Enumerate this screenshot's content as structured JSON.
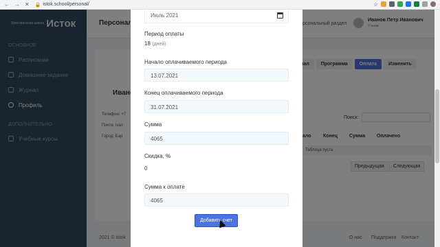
{
  "browser": {
    "url": "istok.school/personal/"
  },
  "sidebar": {
    "brand_small": "Христианская школа",
    "brand_name": "Исток",
    "section_main": "ОСНОВНОЕ",
    "items": [
      {
        "label": "Расписание"
      },
      {
        "label": "Домашнее задание"
      },
      {
        "label": "Журнал"
      },
      {
        "label": "Профиль"
      }
    ],
    "section_extra": "ДОПОЛНИТЕЛЬНО",
    "extra_items": [
      {
        "label": "Учебные курсы"
      }
    ]
  },
  "topbar": {
    "title": "Персонал",
    "section_link": "рсональный раздел",
    "user_name": "Иванов Петр Иванович",
    "user_role": "Ученик"
  },
  "background": {
    "student_name": "Ивано",
    "info": [
      "Телефон: +7",
      "Почта: ivan",
      "Город: Бар"
    ],
    "tabs": [
      "рнал",
      "Программа",
      "Оплата",
      "Изменить"
    ],
    "search_label": "Поиск:",
    "columns": [
      "ало",
      "Конец",
      "Сумма",
      "Оплачено"
    ],
    "empty_text": "Таблица пуста",
    "prev": "Предыдущая",
    "next": "Следующая",
    "footer_left": "2021 © istok",
    "footer_links": [
      "О нас",
      "Поддержка",
      "Контакт"
    ]
  },
  "modal": {
    "month_value": "Июль 2021",
    "period_label": "Период оплаты",
    "period_value": "18",
    "period_unit": "(дней)",
    "start_label": "Начало оплачиваемого периода",
    "start_value": "13.07.2021",
    "end_label": "Конец оплачиваемого периода",
    "end_value": "31.07.2021",
    "sum_label": "Сумма",
    "sum_value": "4065",
    "discount_label": "Скидка, %",
    "discount_value": "0",
    "total_label": "Сумма к оплате",
    "total_value": "4065",
    "submit_label": "Добавить счет"
  },
  "colors": {
    "accent": "#4e73df",
    "sidebar": "#34495e",
    "input_bg": "#f2f8fb"
  }
}
